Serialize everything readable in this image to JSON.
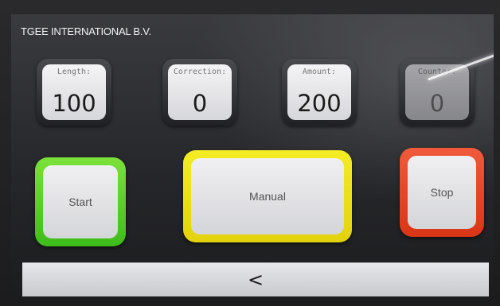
{
  "app": {
    "title": "TGEE INTERNATIONAL B.V."
  },
  "fields": [
    {
      "label": "Length:",
      "value": "100"
    },
    {
      "label": "Correction:",
      "value": "0"
    },
    {
      "label": "Amount:",
      "value": "200"
    },
    {
      "label": "Counter:",
      "value": "0"
    }
  ],
  "buttons": {
    "start_label": "Start",
    "manual_label": "Manual",
    "stop_label": "Stop"
  },
  "nav": {
    "back_label": "<"
  },
  "colors": {
    "start": "#4ccc22",
    "manual": "#ece01a",
    "stop": "#e44424"
  }
}
